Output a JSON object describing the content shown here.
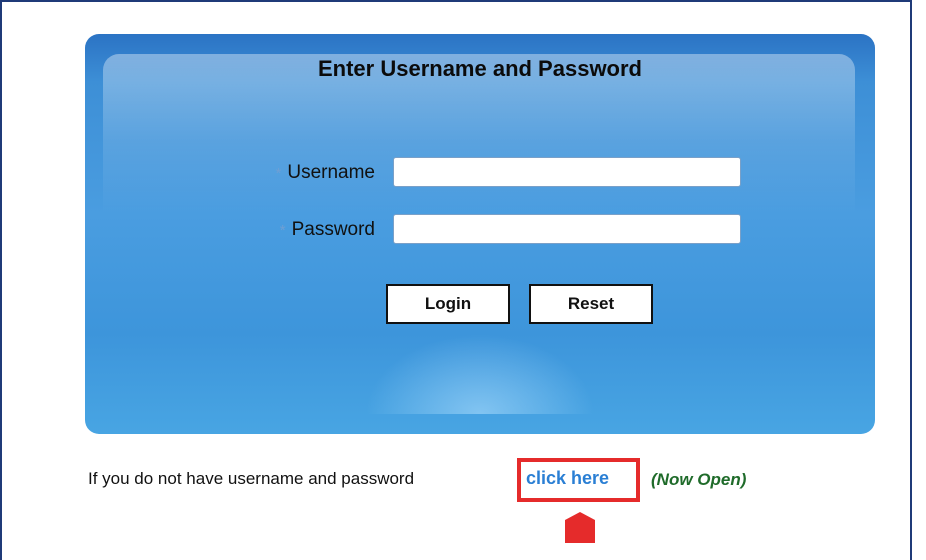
{
  "login_panel": {
    "title": "Enter Username and Password",
    "required_marker": "*",
    "username": {
      "label": "Username",
      "value": "",
      "placeholder": ""
    },
    "password": {
      "label": "Password",
      "value": "",
      "placeholder": ""
    },
    "login_button": "Login",
    "reset_button": "Reset"
  },
  "footer": {
    "prompt": "If you do not have username and password",
    "link": "click here",
    "note": "(Now Open)"
  },
  "colors": {
    "panel_blue": "#3d8fd6",
    "link_blue": "#2a7fd4",
    "highlight_red": "#e52b2b",
    "note_green": "#1f6b2a"
  },
  "icons": {
    "pointer": "arrow-up-marker-icon"
  }
}
